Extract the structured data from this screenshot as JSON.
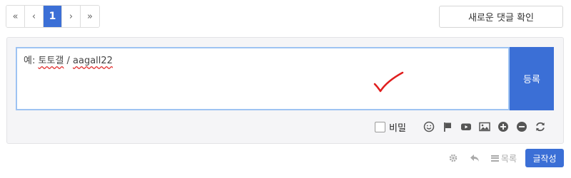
{
  "pagination": {
    "first": "«",
    "prev": "‹",
    "current": "1",
    "next": "›",
    "last": "»"
  },
  "new_comments_button": "새로운 댓글 확인",
  "comment": {
    "text_prefix": "예: ",
    "text_misspelled_1": "토토갤",
    "text_sep": " / ",
    "text_misspelled_2": "aagall22",
    "submit_label": "등록"
  },
  "toolbar": {
    "secret_label": "비밀",
    "secret_checked": false,
    "icons": [
      "emoji-icon",
      "flag-icon",
      "youtube-icon",
      "image-icon",
      "plus-icon",
      "minus-icon",
      "refresh-icon"
    ]
  },
  "footer": {
    "list_label": "목록",
    "write_label": "글작성"
  },
  "colors": {
    "accent": "#3b6fd6",
    "icon_gray": "#555555",
    "muted_gray": "#aaaaaa",
    "annotation_red": "#e01e1e"
  }
}
